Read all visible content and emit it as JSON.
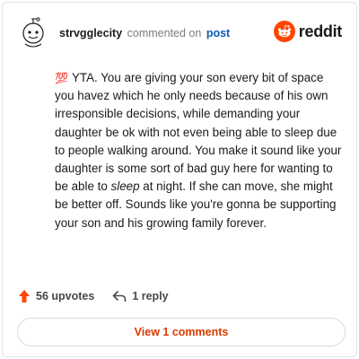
{
  "comment": {
    "username": "strvgglecity",
    "verb": "commented on",
    "post_link": "post",
    "emoji": "💯",
    "body_before_italic": "YTA. You are giving your son every bit of space you havez which he only needs because of his own irresponsible decisions, while demanding your daughter be ok with not even being able to sleep due to people walking around. You make it sound like your daughter is some sort of bad guy here for wanting to be able to ",
    "body_italic": "sleep",
    "body_after_italic": " at night. If she can move, she might be better off. Sounds like you're gonna be supporting your son and his growing family forever."
  },
  "brand": {
    "name": "reddit",
    "logo_icon": "reddit-snoo-icon",
    "color": "#ff4500"
  },
  "actions": {
    "upvotes_label": "56 upvotes",
    "upvote_icon": "upvote-arrow-icon",
    "upvote_color": "#ff4500",
    "reply_label": "1 reply",
    "reply_icon": "reply-arrow-icon"
  },
  "view_comments_label": "View 1 comments",
  "colors": {
    "link": "#0a5bb5",
    "accent": "#d93a00"
  }
}
